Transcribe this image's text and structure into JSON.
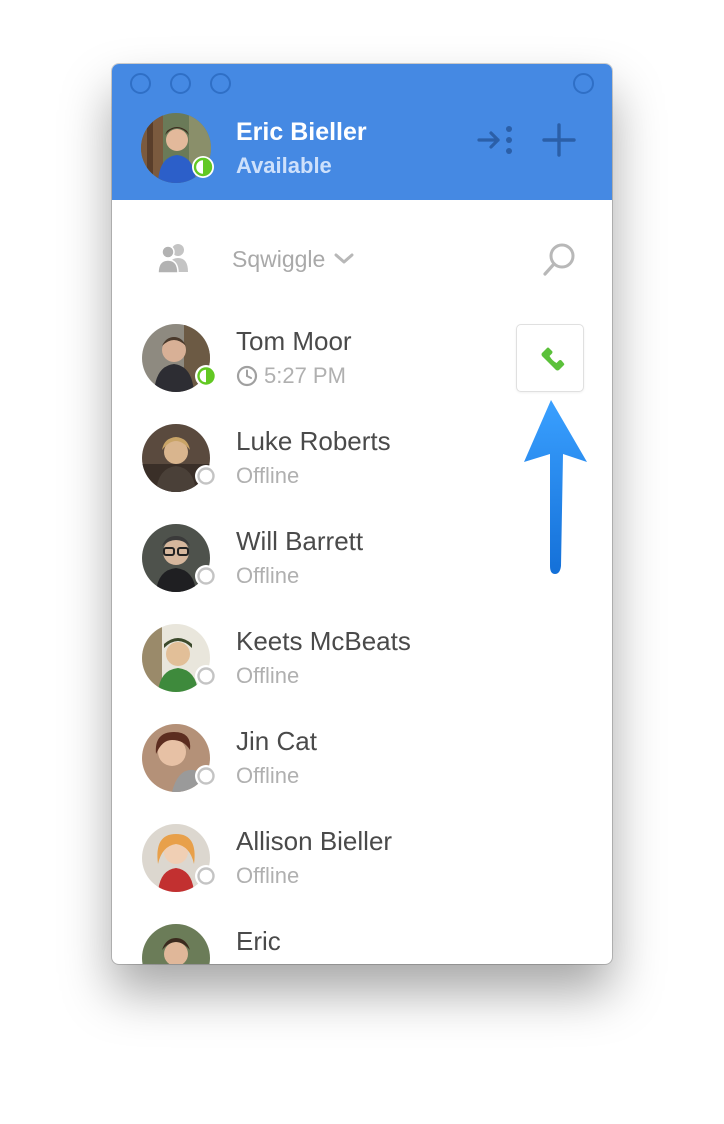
{
  "header": {
    "user_name": "Eric Bieller",
    "user_status": "Available",
    "accent_color": "#4589e3"
  },
  "toolbar": {
    "group_name": "Sqwiggle"
  },
  "contacts": [
    {
      "name": "Tom Moor",
      "status": "5:27 PM",
      "presence": "available"
    },
    {
      "name": "Luke Roberts",
      "status": "Offline",
      "presence": "offline"
    },
    {
      "name": "Will Barrett",
      "status": "Offline",
      "presence": "offline"
    },
    {
      "name": "Keets McBeats",
      "status": "Offline",
      "presence": "offline"
    },
    {
      "name": "Jin Cat",
      "status": "Offline",
      "presence": "offline"
    },
    {
      "name": "Allison Bieller",
      "status": "Offline",
      "presence": "offline"
    },
    {
      "name": "Eric",
      "status": "",
      "presence": "offline"
    }
  ],
  "icons": {
    "window_controls": [
      "close-icon",
      "minimize-icon",
      "zoom-icon",
      "fullscreen-icon"
    ],
    "header_actions": [
      "exit-room-icon",
      "plus-icon"
    ],
    "toolbar": [
      "group-users-icon",
      "chevron-down-icon",
      "search-icon"
    ],
    "call": "phone-icon",
    "annotation": "arrow-up-icon"
  },
  "colors": {
    "online": "#62c823",
    "offline": "#c4c4c4",
    "call_green": "#5bc13a",
    "annotation_arrow": "#1e8bf0"
  }
}
